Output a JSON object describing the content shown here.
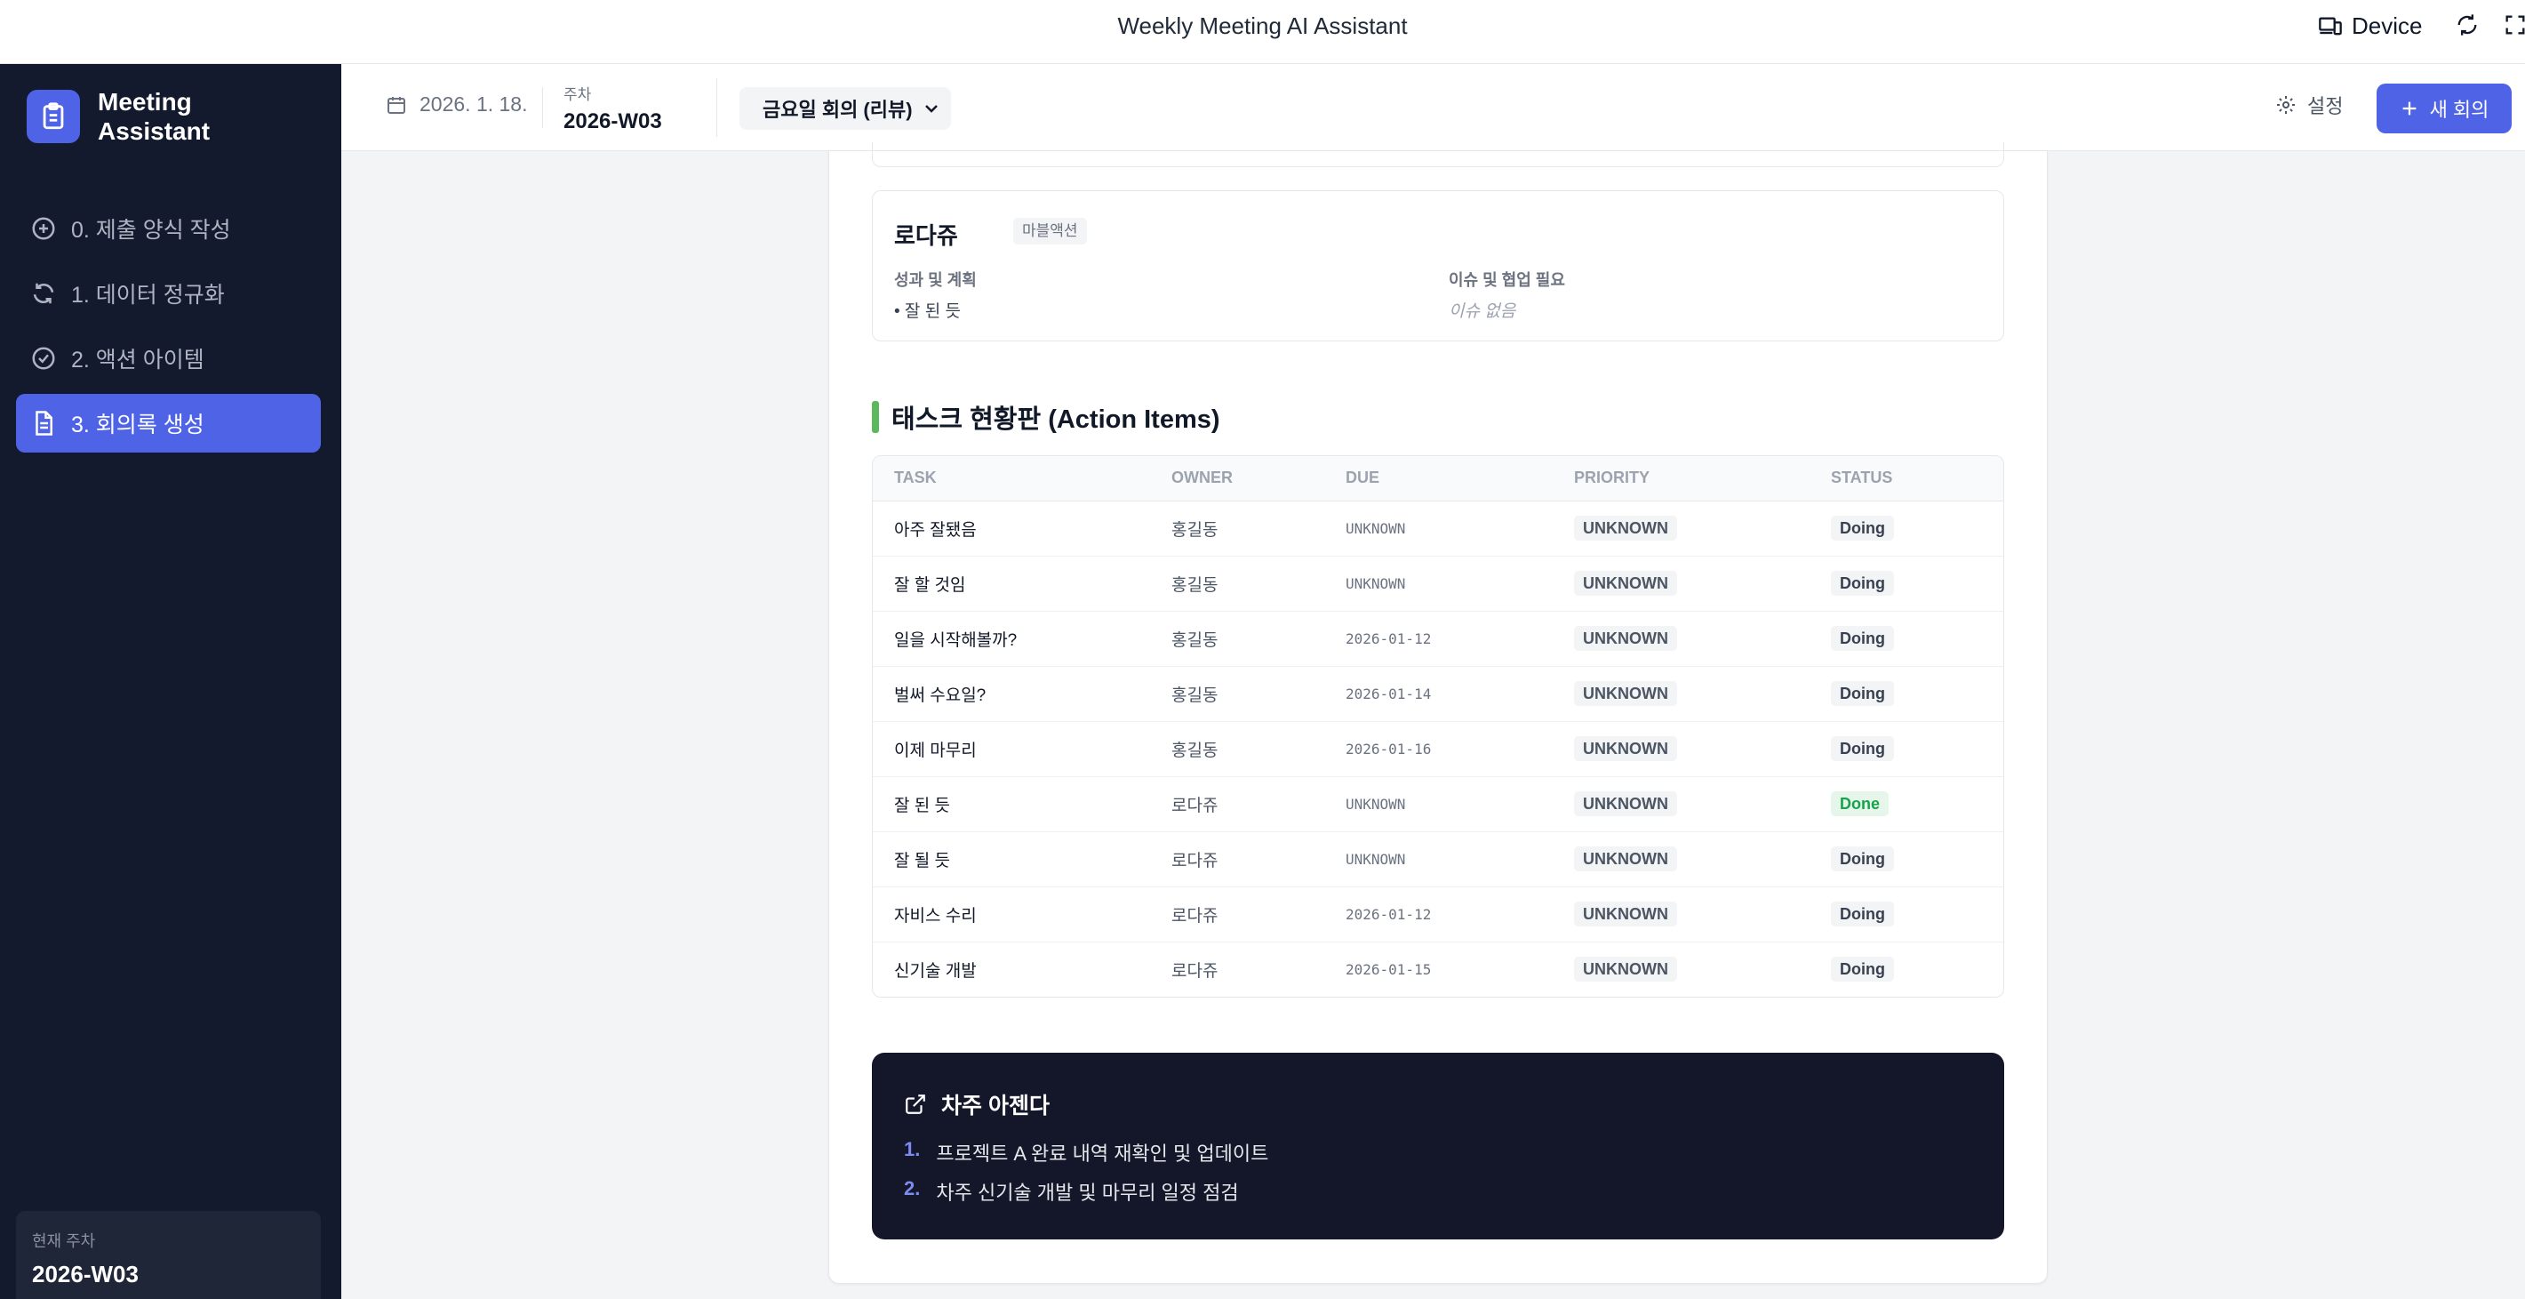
{
  "window": {
    "title": "Weekly Meeting AI Assistant",
    "device_label": "Device"
  },
  "sidebar": {
    "brand_line1": "Meeting",
    "brand_line2": "Assistant",
    "items": [
      {
        "label": "0. 제출 양식 작성",
        "icon": "plus-circle-icon",
        "active": false
      },
      {
        "label": "1. 데이터 정규화",
        "icon": "refresh-icon",
        "active": false
      },
      {
        "label": "2. 액션 아이템",
        "icon": "check-circle-icon",
        "active": false
      },
      {
        "label": "3. 회의록 생성",
        "icon": "document-icon",
        "active": true
      }
    ],
    "current_week_label": "현재 주차",
    "current_week_value": "2026-W03"
  },
  "header": {
    "date": "2026. 1. 18.",
    "week_label": "주차",
    "week_value": "2026-W03",
    "meeting_select": "금요일 회의 (리뷰)",
    "settings_label": "설정",
    "new_meeting_label": "새 회의"
  },
  "member": {
    "name": "로다쥬",
    "team": "마블액션",
    "results_label": "성과 및 계획",
    "results_value": "• 잘 된 듯",
    "issues_label": "이슈 및 협업 필요",
    "issues_value": "이슈 없음"
  },
  "tasks": {
    "title": "태스크 현황판 (Action Items)",
    "headers": [
      "TASK",
      "OWNER",
      "DUE",
      "PRIORITY",
      "STATUS"
    ],
    "rows": [
      {
        "task": "아주 잘됐음",
        "owner": "홍길동",
        "due": "UNKNOWN",
        "priority": "UNKNOWN",
        "status": "Doing"
      },
      {
        "task": "잘 할 것임",
        "owner": "홍길동",
        "due": "UNKNOWN",
        "priority": "UNKNOWN",
        "status": "Doing"
      },
      {
        "task": "일을 시작해볼까?",
        "owner": "홍길동",
        "due": "2026-01-12",
        "priority": "UNKNOWN",
        "status": "Doing"
      },
      {
        "task": "벌써 수요일?",
        "owner": "홍길동",
        "due": "2026-01-14",
        "priority": "UNKNOWN",
        "status": "Doing"
      },
      {
        "task": "이제 마무리",
        "owner": "홍길동",
        "due": "2026-01-16",
        "priority": "UNKNOWN",
        "status": "Doing"
      },
      {
        "task": "잘 된 듯",
        "owner": "로다쥬",
        "due": "UNKNOWN",
        "priority": "UNKNOWN",
        "status": "Done"
      },
      {
        "task": "잘 될 듯",
        "owner": "로다쥬",
        "due": "UNKNOWN",
        "priority": "UNKNOWN",
        "status": "Doing"
      },
      {
        "task": "자비스 수리",
        "owner": "로다쥬",
        "due": "2026-01-12",
        "priority": "UNKNOWN",
        "status": "Doing"
      },
      {
        "task": "신기술 개발",
        "owner": "로다쥬",
        "due": "2026-01-15",
        "priority": "UNKNOWN",
        "status": "Doing"
      }
    ]
  },
  "agenda": {
    "title": "차주 아젠다",
    "items": [
      {
        "num": "1.",
        "text": "프로젝트 A 완료 내역 재확인 및 업데이트"
      },
      {
        "num": "2.",
        "text": "차주 신기술 개발 및 마무리 일정 점검"
      }
    ]
  },
  "colors": {
    "accent": "#4f63e7",
    "sidebar_bg": "#141a2e",
    "section_bar": "#5cb85c",
    "done_green": "#16a34a",
    "agenda_bg": "#131729"
  }
}
